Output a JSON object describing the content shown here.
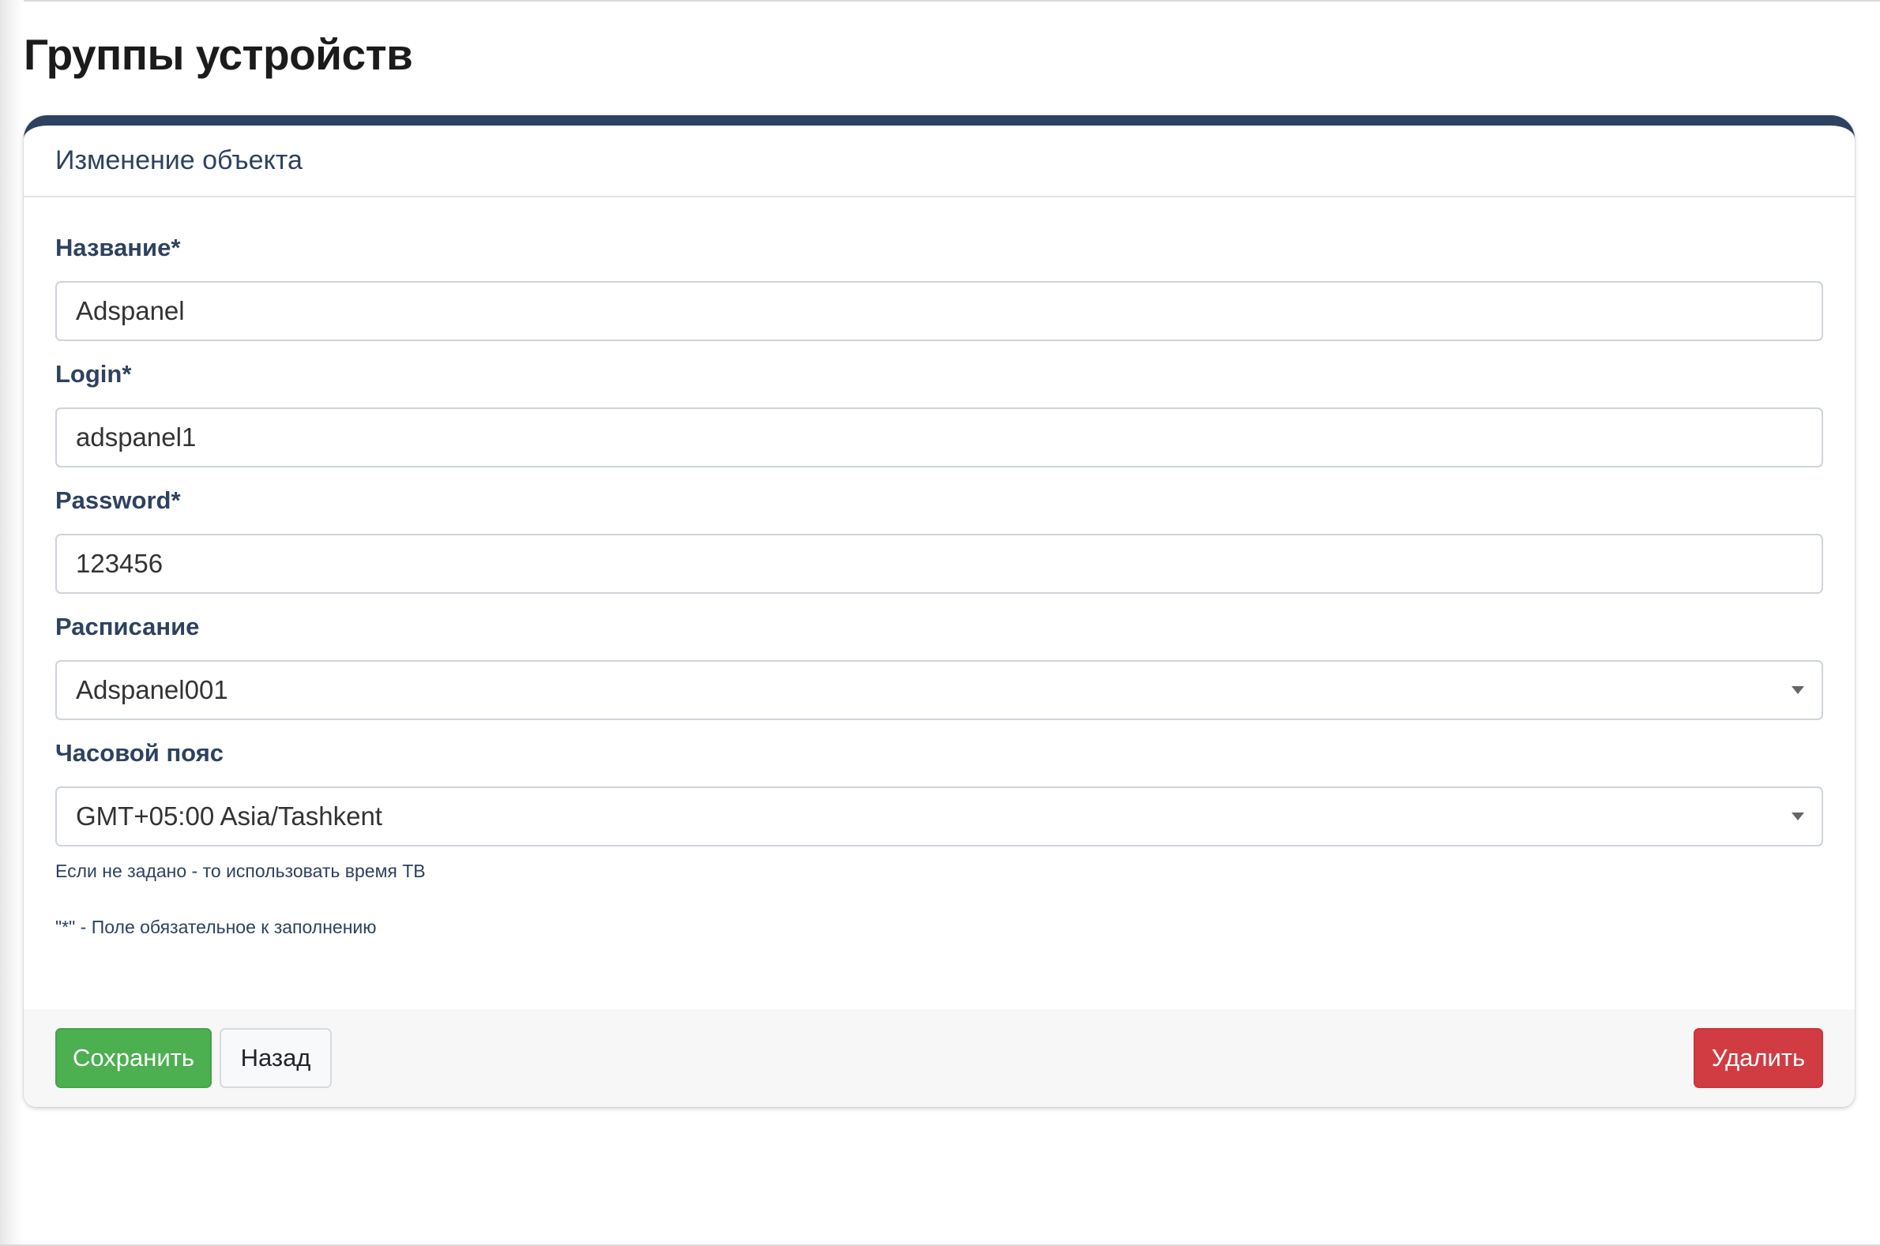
{
  "page": {
    "title": "Группы устройств"
  },
  "card": {
    "title": "Изменение объекта"
  },
  "form": {
    "name": {
      "label": "Название*",
      "value": "Adspanel"
    },
    "login": {
      "label": "Login*",
      "value": "adspanel1"
    },
    "password": {
      "label": "Password*",
      "value": "123456"
    },
    "schedule": {
      "label": "Расписание",
      "selected": "Adspanel001"
    },
    "timezone": {
      "label": "Часовой пояс",
      "selected": "GMT+05:00 Asia/Tashkent",
      "help": "Если не задано - то использовать время ТВ"
    },
    "required_note": "\"*\" - Поле обязательное к заполнению"
  },
  "footer": {
    "save_label": "Сохранить",
    "back_label": "Назад",
    "delete_label": "Удалить"
  },
  "colors": {
    "accent": "#2e4160",
    "save": "#4caf50",
    "delete": "#d13c43"
  },
  "icons": {
    "dropdown": "chevron-down-icon"
  }
}
